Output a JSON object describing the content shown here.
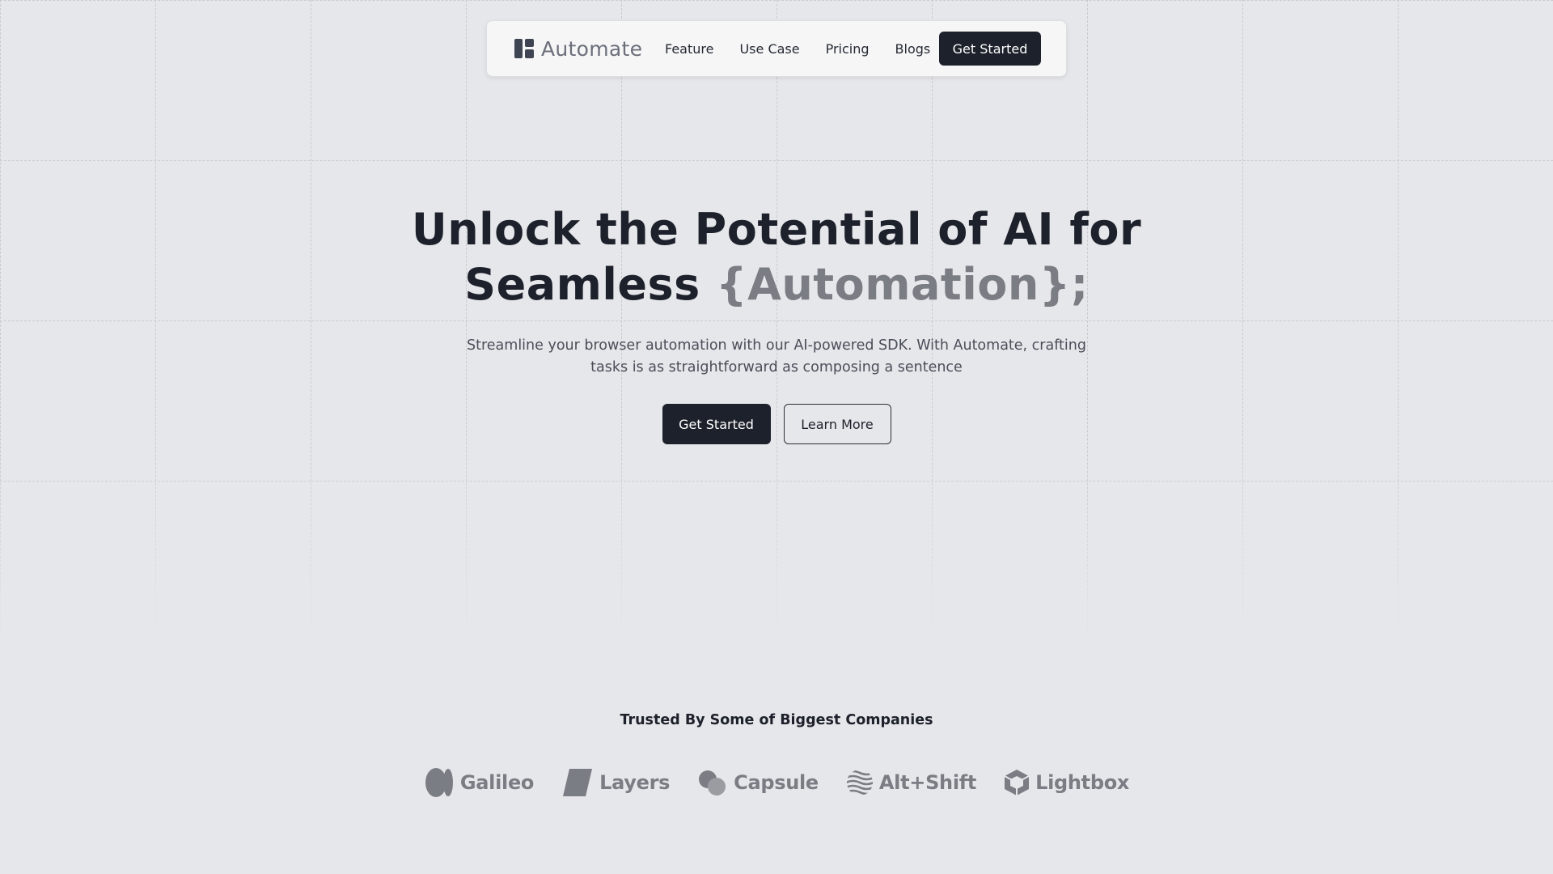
{
  "brand": {
    "name": "Automate",
    "icon": "layout-grid-icon"
  },
  "nav": {
    "links": [
      "Feature",
      "Use Case",
      "Pricing",
      "Blogs"
    ],
    "cta": "Get Started"
  },
  "hero": {
    "title_line1": "Unlock the Potential of AI for",
    "title_line2_prefix": "Seamless ",
    "title_accent": "{Automation};",
    "subtitle": "Streamline your browser automation with our AI-powered SDK. With Automate, crafting tasks is as straightforward as composing a sentence",
    "primary_button": "Get Started",
    "secondary_button": "Learn More"
  },
  "trusted": {
    "title": "Trusted By Some of Biggest Companies",
    "logos": [
      {
        "name": "Galileo",
        "icon": "galileo-logo-icon"
      },
      {
        "name": "Layers",
        "icon": "layers-logo-icon"
      },
      {
        "name": "Capsule",
        "icon": "capsule-logo-icon"
      },
      {
        "name": "Alt+Shift",
        "icon": "altshift-logo-icon"
      },
      {
        "name": "Lightbox",
        "icon": "lightbox-logo-icon"
      }
    ]
  },
  "colors": {
    "background": "#e6e7ea",
    "primary": "#1d212b",
    "accent_text": "#7b7d84",
    "grid_line": "#c9cbd0"
  }
}
